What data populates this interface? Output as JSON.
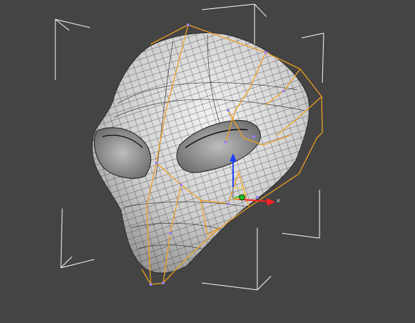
{
  "viewport": {
    "background": "#444444",
    "object": "alien-head-mesh"
  },
  "gizmo": {
    "x_label": "x",
    "x_color": "#ff2020",
    "y_color": "#20c020",
    "z_color": "#2040ff",
    "icon": "move-transform-gizmo"
  },
  "colors": {
    "bounding_box": "#ffffff",
    "cage": "#f0a020",
    "vertex": "#9a7dff",
    "mesh_fill": "#cfcfcf",
    "mesh_wire": "#1a1a1a"
  }
}
